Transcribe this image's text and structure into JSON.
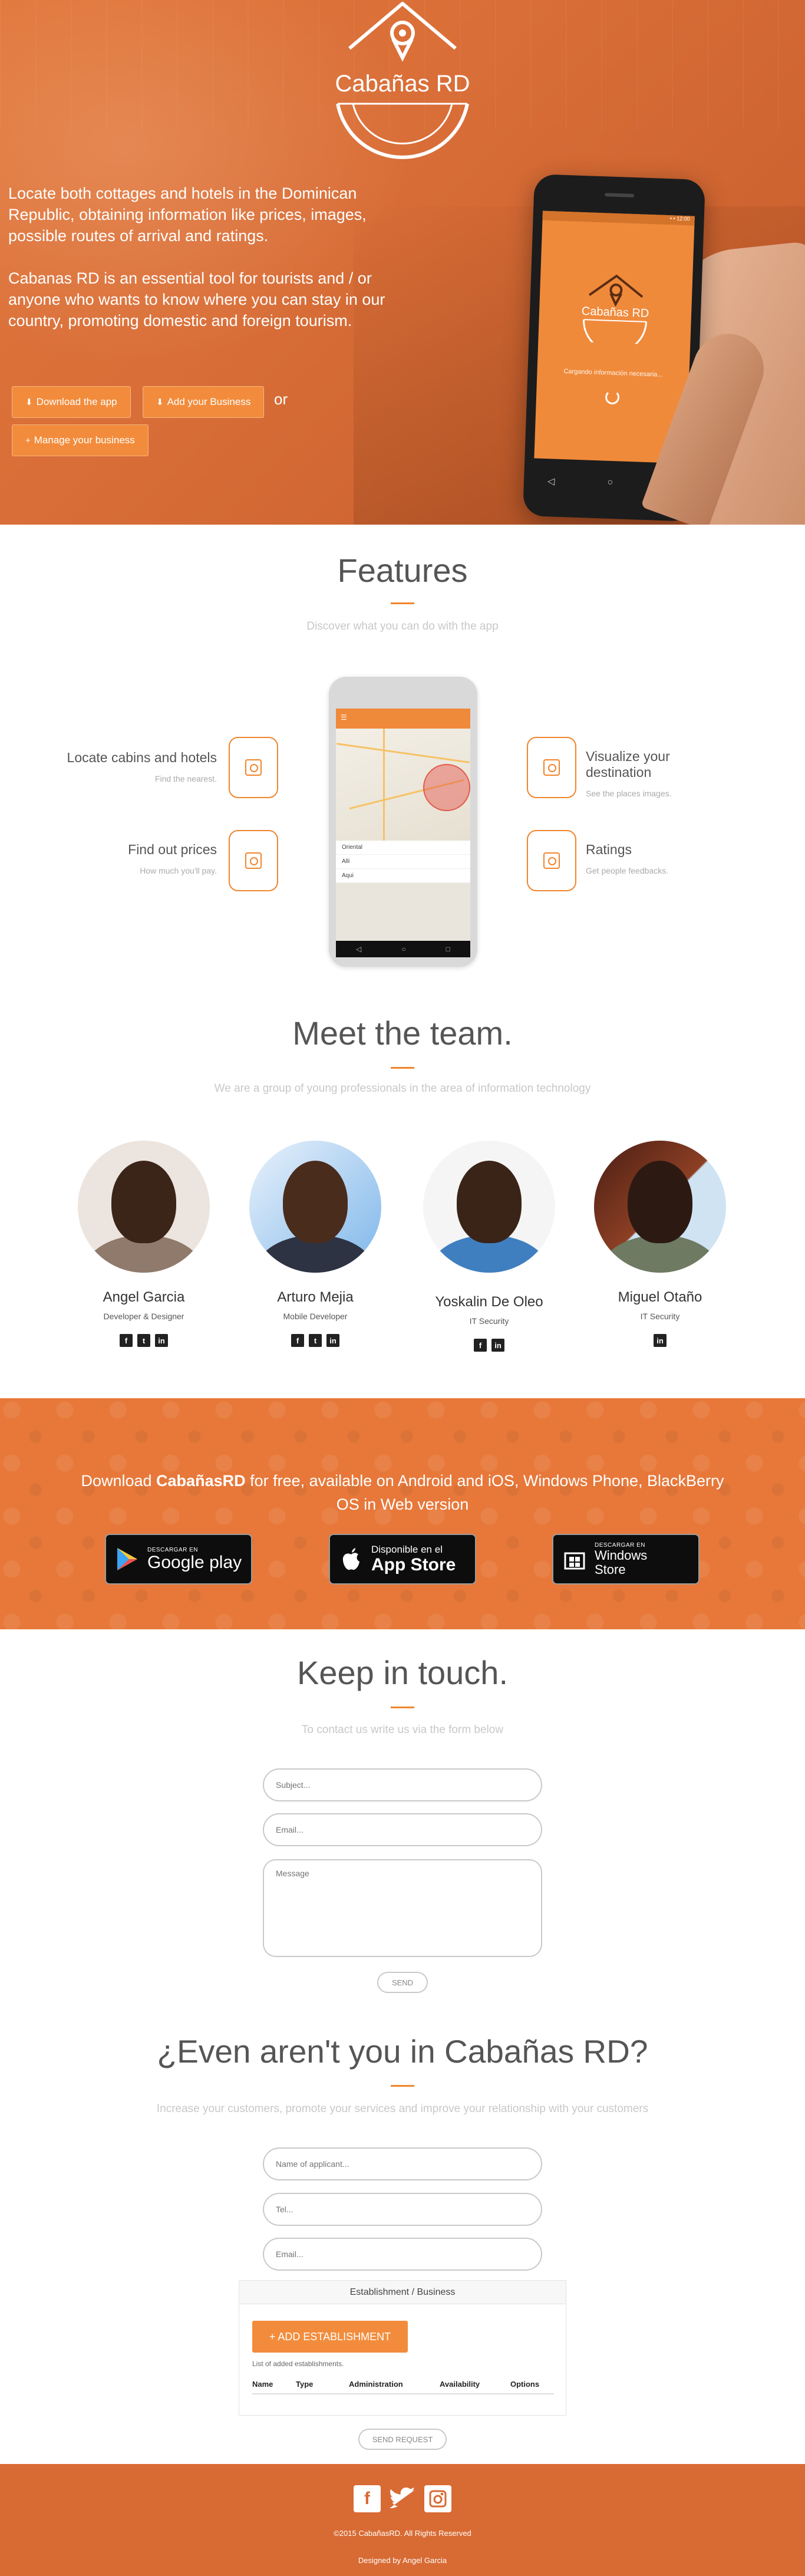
{
  "brand": {
    "accent": "#f0852d",
    "hero_bg": "#d96e38",
    "footer_bg": "#d86a33",
    "logo_text": "Cabañas RD"
  },
  "hero": {
    "paragraph1": "Locate both cottages and hotels in the Dominican Republic, obtaining information like prices, images, possible routes of arrival and ratings.",
    "paragraph2": "Cabanas RD is an essential tool for tourists and / or anyone who wants to know where you can stay in our country, promoting domestic and foreign tourism.",
    "download_button": "Download the app",
    "add_business_button": "Add your Business",
    "or_text": "or",
    "manage_button": "Manage your business",
    "phone_loading_text": "Cargando información necesaria..."
  },
  "features": {
    "title": "Features",
    "subtitle": "Discover what you can do with the app",
    "items": [
      {
        "title": "Locate cabins and hotels",
        "subtitle": "Find the nearest.",
        "icon": "map-icon"
      },
      {
        "title": "Find out prices",
        "subtitle": "How much you'll pay.",
        "icon": "price-icon"
      },
      {
        "title": "Visualize your destination",
        "subtitle": "See the places images.",
        "icon": "image-icon"
      },
      {
        "title": "Ratings",
        "subtitle": "Get people feedbacks.",
        "icon": "rating-icon"
      }
    ],
    "phone_list": [
      "Oriental",
      "Alli",
      "Aqui"
    ]
  },
  "team": {
    "title": "Meet the team.",
    "subtitle": "We are a group of young professionals in the area of information technology",
    "members": [
      {
        "name": "Angel Garcia",
        "role": "Developer & Designer"
      },
      {
        "name": "Arturo Mejia",
        "role": "Mobile Developer"
      },
      {
        "name": "Yoskalin De Oleo",
        "role": "IT Security"
      },
      {
        "name": "Miguel Otaño",
        "role": "IT Security"
      }
    ]
  },
  "download": {
    "text_before": "Download ",
    "brand": "CabañasRD",
    "text_after": " for free, available on Android and iOS, Windows Phone, BlackBerry OS in Web version",
    "google_small": "DESCARGAR EN",
    "google_big": "Google play",
    "apple_small": "Disponible en el",
    "apple_big": "App Store",
    "windows_small": "DESCARGAR EN",
    "windows_big": "Windows Store"
  },
  "contact": {
    "title": "Keep in touch.",
    "subtitle": "To contact us write us via the form below",
    "subject_placeholder": "Subject...",
    "email_placeholder": "Email...",
    "message_placeholder": "Message",
    "send_button": "SEND"
  },
  "join": {
    "title": "¿Even aren't you in Cabañas RD?",
    "subtitle": "Increase your customers, promote your services and improve your relationship with your customers",
    "name_placeholder": "Name of applicant...",
    "tel_placeholder": "Tel...",
    "email_placeholder": "Email...",
    "panel_title": "Establishment / Business",
    "add_button": "+ ADD ESTABLISHMENT",
    "list_label": "List of added establishments.",
    "columns": [
      "Name",
      "Type",
      "Administration",
      "Availability",
      "Options"
    ],
    "send_button": "SEND REQUEST"
  },
  "footer": {
    "copyright": "©2015 CabañasRD. All Rights Reserved",
    "designed_by": "Designed by Angel Garcia"
  }
}
